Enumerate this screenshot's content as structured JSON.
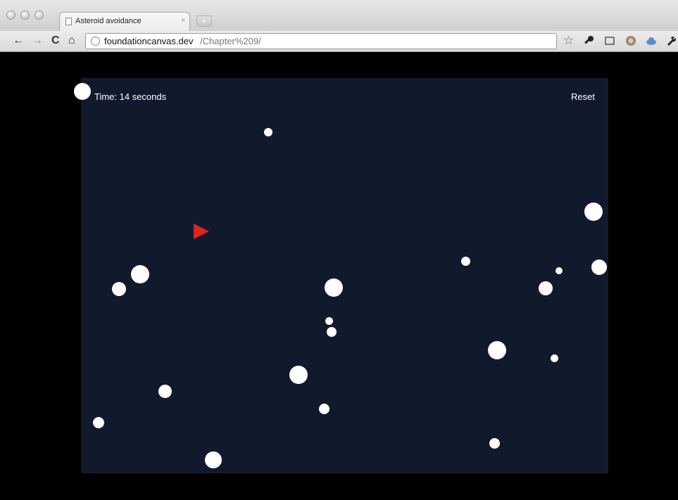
{
  "browser": {
    "tab_title": "Asteroid avoidance",
    "tab_close": "×",
    "new_tab": "+",
    "address_host": "foundationcanvas.dev",
    "address_path": "/Chapter%209/",
    "toolbar_icons": [
      "back-icon",
      "forward-icon",
      "reload-icon",
      "home-icon",
      "bookmark-star-icon",
      "key-icon",
      "screen-icon",
      "extension-icon",
      "cloud-icon",
      "wrench-icon"
    ],
    "back_glyph": "←",
    "forward_glyph": "→",
    "reload_glyph": "C",
    "home_glyph": "⌂",
    "star_glyph": "☆"
  },
  "game": {
    "time_text": "Time: 14 seconds",
    "reset_label": "Reset",
    "canvas_color": "#111a2d",
    "ship_color": "#e0231d",
    "asteroid_color": "#ffffff"
  }
}
